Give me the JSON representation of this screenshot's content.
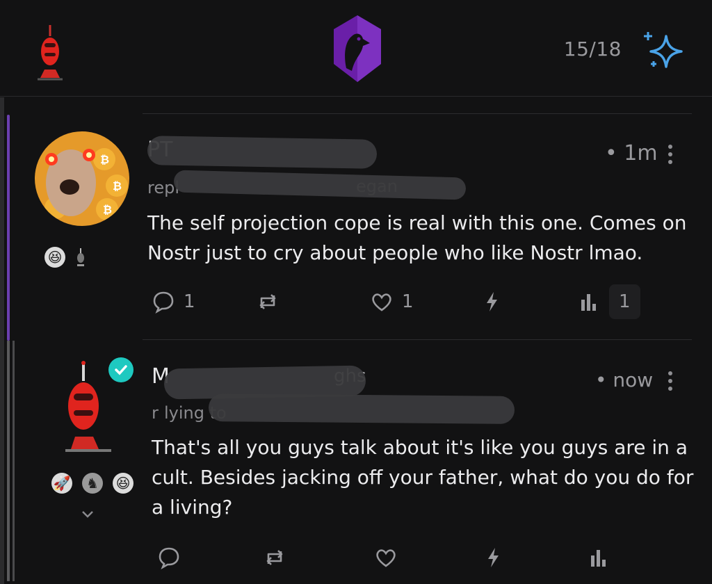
{
  "header": {
    "counter": "15/18",
    "icons": {
      "left": "robot-avatar-icon",
      "center": "app-logo-icon",
      "right": "sparkle-icon"
    },
    "accent": "#4aa3e8",
    "logo_color": "#7b2fb5"
  },
  "posts": [
    {
      "author_prefix": "PT",
      "reply_prefix": "repl",
      "reply_suffix": "egan",
      "time": "1m",
      "text_line1": "The self projection cope is real with this one. Comes on",
      "text_line2": "Nostr just to cry about people who like Nostr lmao.",
      "replies": "1",
      "likes": "1",
      "stats": "1"
    },
    {
      "author_prefix": "M",
      "author_suffix": "ghs",
      "reply_prefix": "r",
      "reply_mid": "lying to",
      "time": "now",
      "text_line1": "That's all you guys talk about it's like you guys are in a",
      "text_line2": "cult. Besides jacking off your father, what do you do for",
      "text_line3": "a living?"
    }
  ],
  "colors": {
    "thread_line": "#6b3fb0",
    "verified": "#1ec9c0"
  }
}
